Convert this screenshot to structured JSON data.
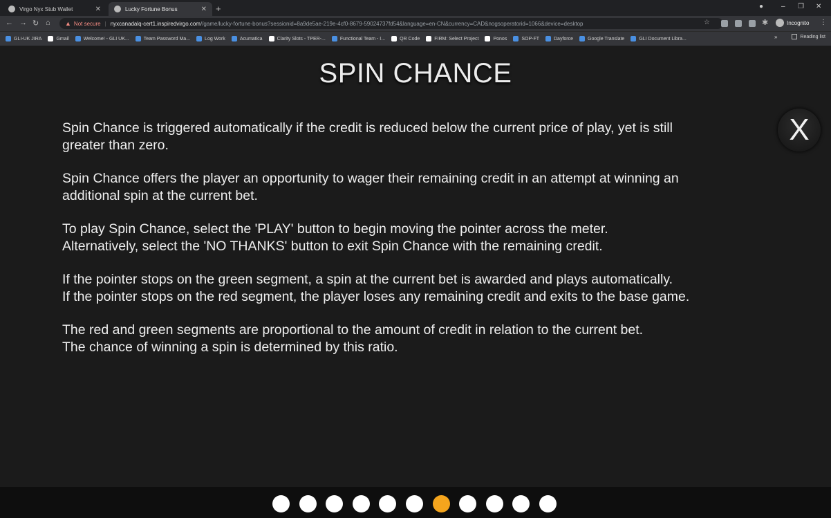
{
  "browser": {
    "tabs": [
      {
        "label": "Virgo Nyx Stub Wallet",
        "active": false
      },
      {
        "label": "Lucky Fortune Bonus",
        "active": true
      }
    ],
    "new_tab": "+",
    "window_controls": {
      "minimize": "–",
      "restore": "❐",
      "close": "✕"
    },
    "url": {
      "security_label": "Not secure",
      "host": "nyxcanadalq-cert1.inspiredvirgo.com",
      "path": "//game/lucky-fortune-bonus?sessionid=8a9de5ae-219e-4cf0-8679-59024737fd54&language=en-CN&currency=CAD&nogsoperatorid=1066&device=desktop"
    },
    "profile_label": "Incognito",
    "bookmarks": [
      {
        "label": "GLI-UK JIRA",
        "color": "#4a90e2"
      },
      {
        "label": "Gmail",
        "color": "#ffffff"
      },
      {
        "label": "Welcome! - GLI UK...",
        "color": "#4a90e2"
      },
      {
        "label": "Team Password Ma...",
        "color": "#4a90e2"
      },
      {
        "label": "Log Work",
        "color": "#4a90e2"
      },
      {
        "label": "Acumatica",
        "color": "#4a90e2"
      },
      {
        "label": "Clarity Slots - TPER-...",
        "color": "#ffffff"
      },
      {
        "label": "Functional Team - I...",
        "color": "#4a90e2"
      },
      {
        "label": "QR Code",
        "color": "#ffffff"
      },
      {
        "label": "FIRM: Select Project",
        "color": "#ffffff"
      },
      {
        "label": "Ponos",
        "color": "#ffffff"
      },
      {
        "label": "SOP-FT",
        "color": "#4a90e2"
      },
      {
        "label": "Dayforce",
        "color": "#4a90e2"
      },
      {
        "label": "Google Translate",
        "color": "#4a90e2"
      },
      {
        "label": "GLI Document Libra...",
        "color": "#4a90e2"
      }
    ],
    "bookmarks_more": "»",
    "reading_list": "Reading list"
  },
  "page": {
    "title": "SPIN CHANCE",
    "close_label": "X",
    "paragraphs": [
      {
        "lines": [
          "Spin Chance is triggered automatically if the credit is reduced below the current price of play, yet is still",
          "greater than zero."
        ]
      },
      {
        "lines": [
          "Spin Chance offers the player an opportunity to wager their remaining credit in an attempt at winning an",
          "additional spin at the current bet."
        ]
      },
      {
        "lines": [
          "To play Spin Chance, select the 'PLAY' button to begin moving the pointer across the meter.",
          "Alternatively, select the 'NO THANKS' button to exit Spin Chance with the remaining credit."
        ]
      },
      {
        "lines": [
          "If the pointer stops on the green segment, a spin at the current bet is awarded and plays automatically.",
          "If the pointer stops on the red segment, the player loses any remaining credit and exits to the base game."
        ]
      },
      {
        "lines": [
          "The red and green segments are proportional to the amount of credit in relation to the current bet.",
          "The chance of winning a spin is determined by this ratio."
        ]
      }
    ]
  },
  "pagination": {
    "count": 11,
    "active_index": 6,
    "colors": {
      "dot": "#ffffff",
      "active": "#f5a51d"
    }
  }
}
